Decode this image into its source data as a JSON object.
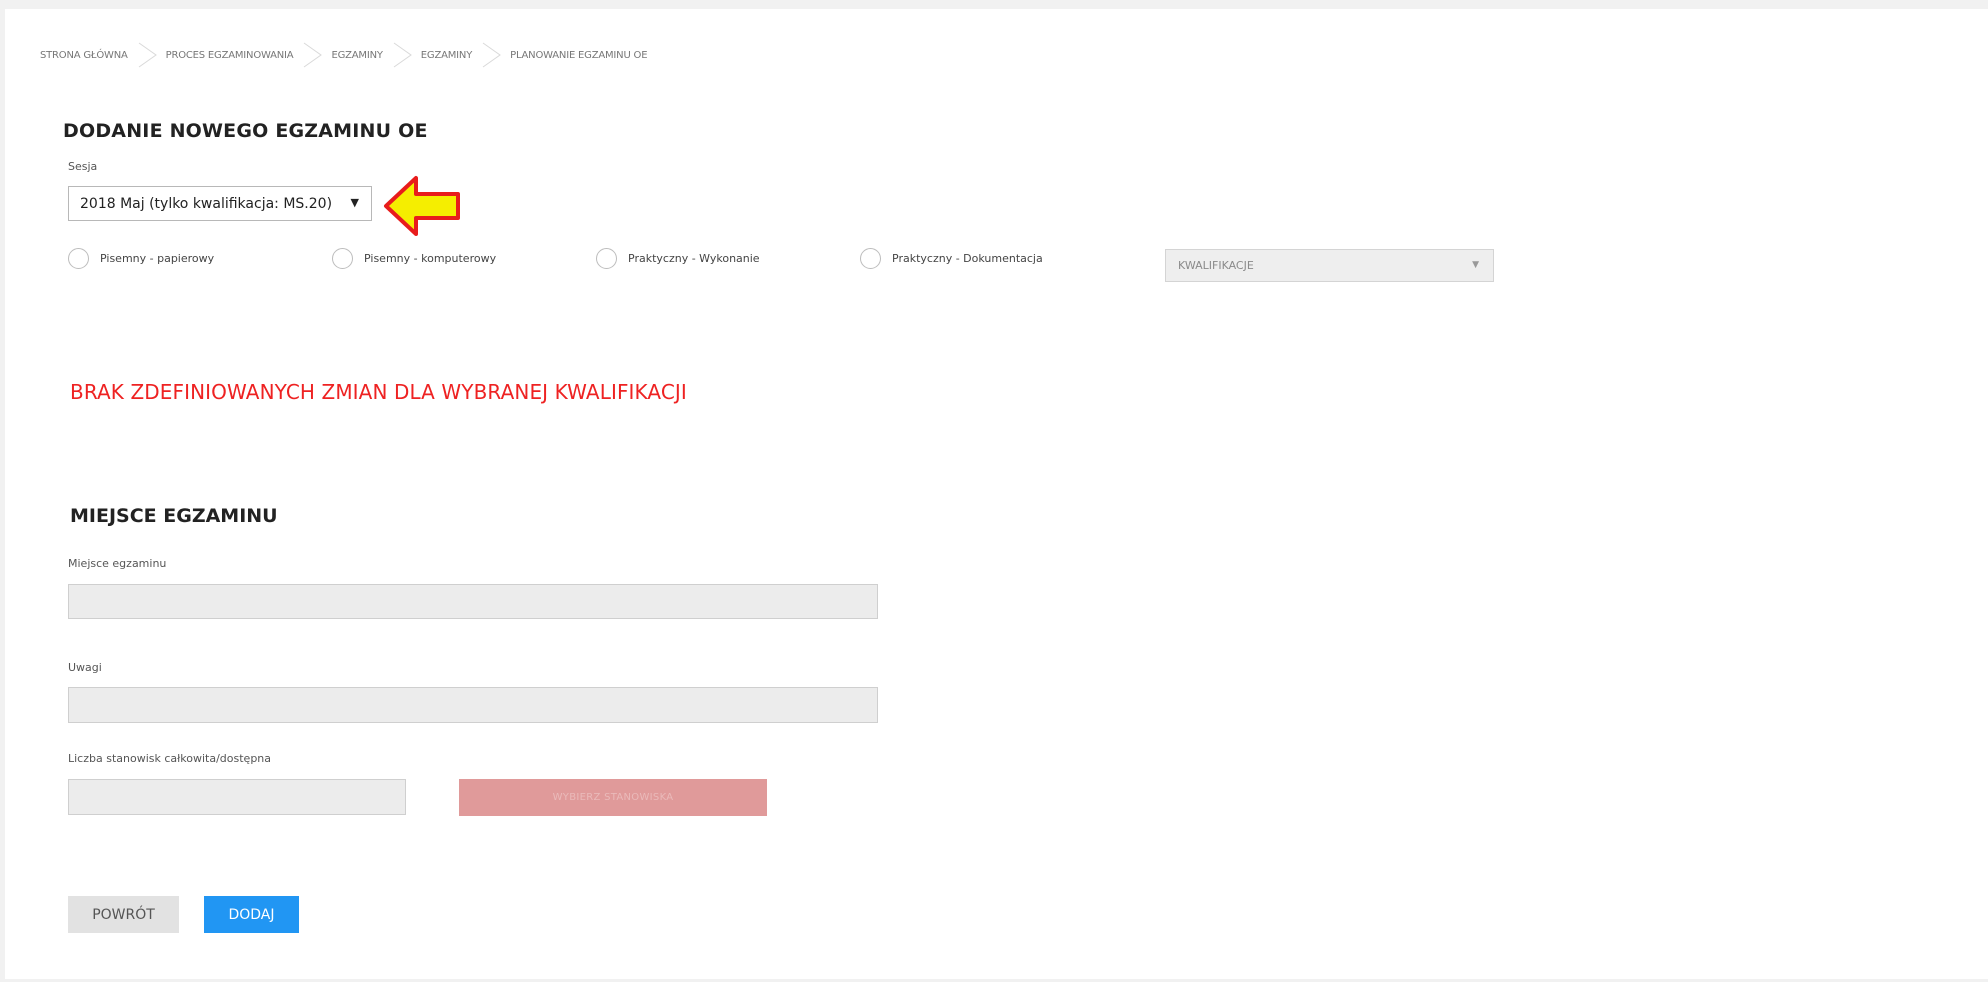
{
  "breadcrumb": [
    "STRONA GŁÓWNA",
    "PROCES EGZAMINOWANIA",
    "EGZAMINY",
    "EGZAMINY",
    "PLANOWANIE EGZAMINU OE"
  ],
  "form": {
    "title": "DODANIE NOWEGO EGZAMINU OE",
    "session_label": "Sesja",
    "session_value": "2018 Maj (tylko kwalifikacja: MS.20)",
    "radios": [
      "Pisemny - papierowy",
      "Pisemny - komputerowy",
      "Praktyczny - Wykonanie",
      "Praktyczny - Dokumentacja"
    ],
    "qualification_placeholder": "KWALIFIKACJE",
    "warning": "BRAK ZDEFINIOWANYCH ZMIAN DLA WYBRANEJ KWALIFIKACJI"
  },
  "place": {
    "section_title": "MIEJSCE EGZAMINU",
    "place_label": "Miejsce egzaminu",
    "notes_label": "Uwagi",
    "seats_label": "Liczba stanowisk całkowita/dostępna",
    "disabled_button_label": "WYBIERZ STANOWISKA"
  },
  "actions": {
    "back_label": "POWRÓT",
    "add_label": "DODAJ"
  },
  "colors": {
    "accent": "#2196f3",
    "warning": "#ee2222",
    "annotation_arrow_fill": "#f5ee00",
    "annotation_arrow_stroke": "#e81c1c"
  }
}
